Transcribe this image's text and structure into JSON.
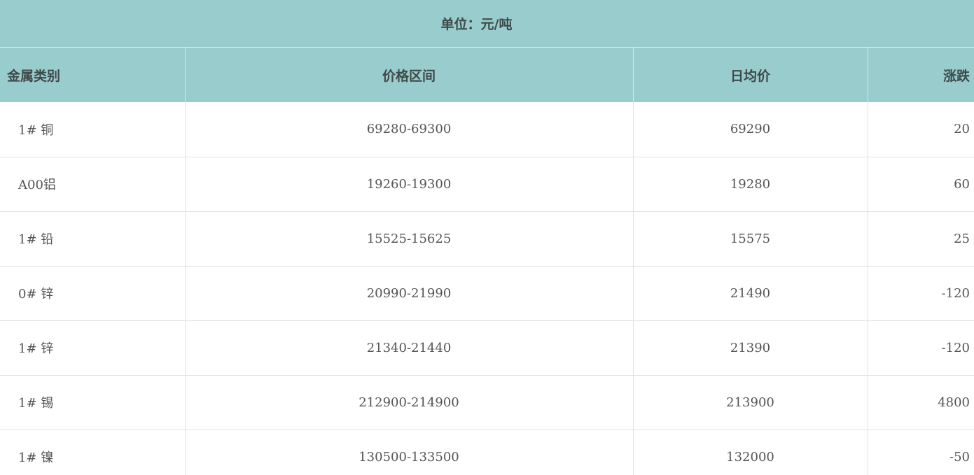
{
  "unit_label": "单位：元/吨",
  "columns": [
    "金属类别",
    "价格区间",
    "日均价",
    "涨跌"
  ],
  "rows": [
    {
      "metal": "1# 铜",
      "range": "69280-69300",
      "avg": "69290",
      "change": "20"
    },
    {
      "metal": "A00铝",
      "range": "19260-19300",
      "avg": "19280",
      "change": "60"
    },
    {
      "metal": "1# 铅",
      "range": "15525-15625",
      "avg": "15575",
      "change": "25"
    },
    {
      "metal": "0# 锌",
      "range": "20990-21990",
      "avg": "21490",
      "change": "-120"
    },
    {
      "metal": "1# 锌",
      "range": "21340-21440",
      "avg": "21390",
      "change": "-120"
    },
    {
      "metal": "1# 锡",
      "range": "212900-214900",
      "avg": "213900",
      "change": "4800"
    },
    {
      "metal": "1# 镍",
      "range": "130500-133500",
      "avg": "132000",
      "change": "-50"
    }
  ],
  "colors": {
    "header_bg": "#99cccc",
    "header_text": "#3f4a4a",
    "body_text": "#555555",
    "grid_line": "#e0e0e0"
  }
}
